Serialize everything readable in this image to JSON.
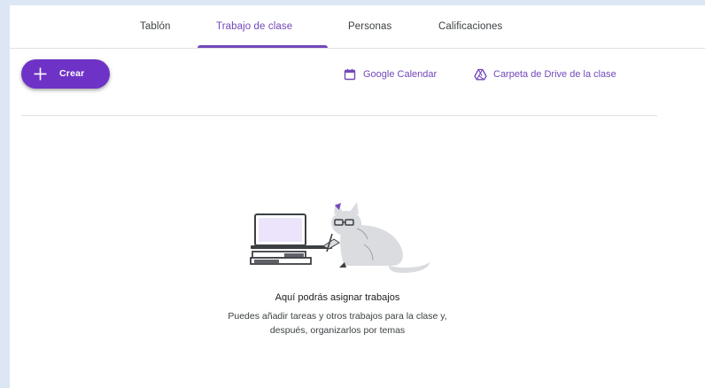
{
  "tabs": [
    {
      "label": "Tablón"
    },
    {
      "label": "Trabajo de clase"
    },
    {
      "label": "Personas"
    },
    {
      "label": "Calificaciones"
    }
  ],
  "active_tab": "Trabajo de clase",
  "create_button": {
    "label": "Crear",
    "icon": "plus-icon"
  },
  "links": {
    "calendar": {
      "label": "Google Calendar",
      "icon": "calendar-icon"
    },
    "drive": {
      "label": "Carpeta de Drive de la clase",
      "icon": "drive-icon"
    }
  },
  "empty_state": {
    "title": "Aquí podrás asignar trabajos",
    "description_line1": "Puedes añadir tareas y otros trabajos para la clase y,",
    "description_line2": "después, organizarlos por temas"
  },
  "colors": {
    "accent": "#7248b9",
    "button": "#6f32c6",
    "background": "#dce6f5"
  }
}
